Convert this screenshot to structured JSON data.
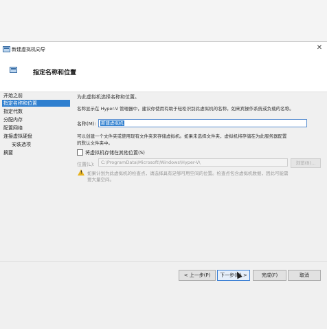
{
  "window": {
    "title": "新建虚拟机向导",
    "close_glyph": "✕"
  },
  "header": {
    "title": "指定名称和位置"
  },
  "sidebar": {
    "items": [
      {
        "label": "开始之前"
      },
      {
        "label": "指定名称和位置"
      },
      {
        "label": "指定代数"
      },
      {
        "label": "分配内存"
      },
      {
        "label": "配置网络"
      },
      {
        "label": "连接虚拟硬盘"
      },
      {
        "label": "安装选项"
      },
      {
        "label": "摘要"
      }
    ]
  },
  "content": {
    "intro": "为此虚拟机选择名称和位置。",
    "name_hint": "名称显示在 Hyper-V 管理器中，建议你使用有助于轻松识别此虚拟机的名称，如来宾操作系统或负载的名称。",
    "name_label": "名称(M):",
    "name_value": "新建虚拟机",
    "folder_text_1": "可以创建一个文件夹或使用现有文件夹来存储虚拟机。如果未选择文件夹，虚拟机将存储在为此服务器配置",
    "folder_text_2": "的默认文件夹中。",
    "store_checkbox_label": "将虚拟机存储在其他位置(S)",
    "location_label": "位置(L):",
    "location_value": "C:\\ProgramData\\Microsoft\\Windows\\Hyper-V\\",
    "browse_label": "浏览(B)...",
    "warning_line_1": "如果计划为此虚拟机的检查点，请选择具有足够可用空间的位置。检查点包含虚拟机数据，因此可能需",
    "warning_line_2": "要大量空间。"
  },
  "buttons": {
    "prev": "< 上一步(P)",
    "next": "下一步(N) >",
    "finish": "完成(F)",
    "cancel": "取消"
  },
  "icons": [
    "vm-wizard-icon",
    "warning-icon",
    "close-icon"
  ],
  "colors": {
    "selection_blue": "#2f7fcf",
    "warning_yellow": "#e8b320"
  }
}
